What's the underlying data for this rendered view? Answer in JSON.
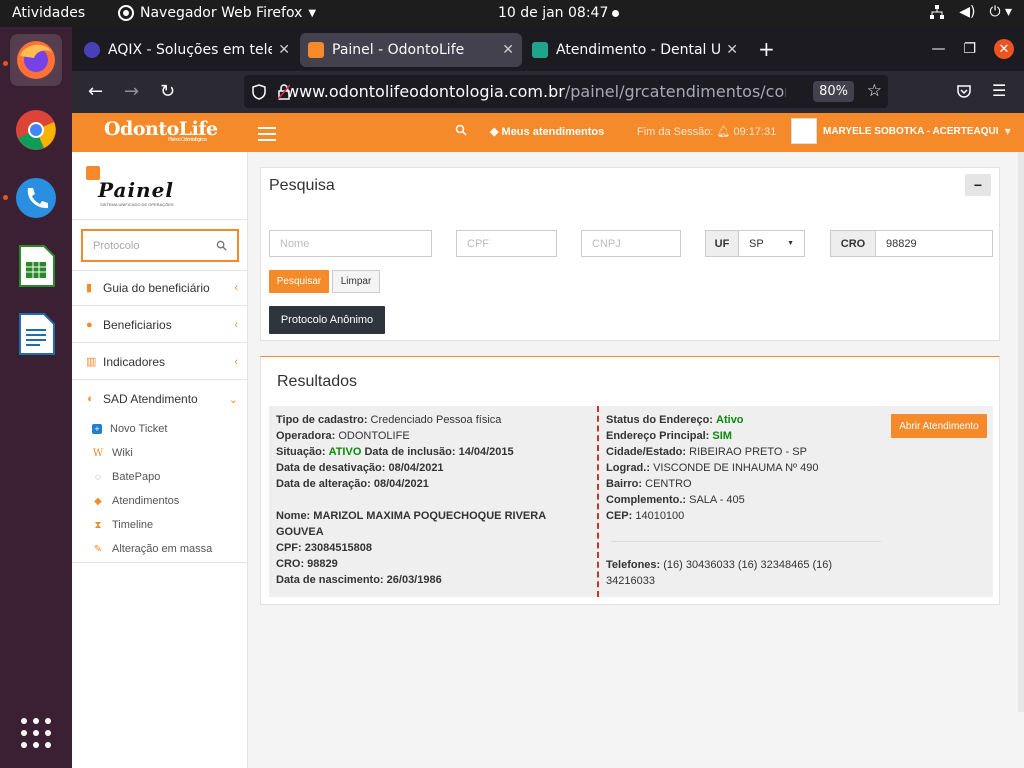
{
  "topbar": {
    "activities": "Atividades",
    "app_menu": "Navegador Web Firefox",
    "clock": "10 de jan  08:47"
  },
  "dock": {
    "apps": [
      "firefox-icon",
      "chrome-icon",
      "phone-icon",
      "calc-icon",
      "writer-icon",
      "apps-grid-icon"
    ]
  },
  "browser": {
    "tabs": [
      {
        "title": "AQIX - Soluções em telefonia",
        "active": false
      },
      {
        "title": "Painel - OdontoLife",
        "active": true
      },
      {
        "title": "Atendimento - Dental Uni",
        "active": false
      }
    ],
    "url_host": "www.odontolifeodontologia.com.br",
    "url_path": "/painel/grcatendimentos/consulta/i",
    "zoom": "80%"
  },
  "header": {
    "logo": "OdontoLife",
    "logo_sub": "Planos Odontológicos",
    "meus_atendimentos": "Meus atendimentos",
    "sessao_label": "Fim da Sessão:",
    "sessao_time": "09:17:31",
    "user": "MARYELE SOBOTKA - ACERTEAQUI"
  },
  "sidebar": {
    "painel": "Painel",
    "painel_sub": "SISTEMA UNIFICADO DE OPERAÇÕES",
    "protocolo_placeholder": "Protocolo",
    "menu": [
      {
        "label": "Guia do beneficiário"
      },
      {
        "label": "Beneficiarios"
      },
      {
        "label": "Indicadores"
      },
      {
        "label": "SAD Atendimento"
      }
    ],
    "submenu": [
      {
        "label": "Novo Ticket"
      },
      {
        "label": "Wiki"
      },
      {
        "label": "BatePapo"
      },
      {
        "label": "Atendimentos"
      },
      {
        "label": "Timeline"
      },
      {
        "label": "Alteração em massa"
      }
    ]
  },
  "pesquisa": {
    "title": "Pesquisa",
    "nome_placeholder": "Nome",
    "cpf_placeholder": "CPF",
    "cnpj_placeholder": "CNPJ",
    "uf_label": "UF",
    "uf_value": "SP",
    "cro_label": "CRO",
    "cro_value": "98829",
    "btn_pesquisar": "Pesquisar",
    "btn_limpar": "Limpar",
    "btn_anonimo": "Protocolo Anônimo"
  },
  "resultados": {
    "title": "Resultados",
    "btn_abrir": "Abrir Atendimento",
    "tipo_label": "Tipo de cadastro:",
    "tipo_value": "Credenciado Pessoa física",
    "operadora_label": "Operadora:",
    "operadora_value": "ODONTOLIFE",
    "situacao_label": "Situação:",
    "situacao_value": "ATIVO",
    "inclusao_label": "Data de inclusão:",
    "inclusao_value": "14/04/2015",
    "desativacao_label": "Data de desativação:",
    "desativacao_value": "08/04/2021",
    "alteracao_label": "Data de alteração:",
    "alteracao_value": "08/04/2021",
    "nome_label": "Nome:",
    "nome_value_1": "MARIZOL MAXIMA POQUECHOQUE RIVERA",
    "nome_value_2": "GOUVEA",
    "cpf_label": "CPF:",
    "cpf_value": "23084515808",
    "cro_label": "CRO:",
    "cro_value": "98829",
    "nasc_label": "Data de nascimento:",
    "nasc_value": "26/03/1986",
    "status_end_label": "Status do Endereço:",
    "status_end_value": "Ativo",
    "end_principal_label": "Endereço Principal:",
    "end_principal_value": "SIM",
    "cidade_label": "Cidade/Estado:",
    "cidade_value": "RIBEIRAO PRETO - SP",
    "lograd_label": "Lograd.:",
    "lograd_value": "VISCONDE DE INHAUMA Nº 490",
    "bairro_label": "Bairro:",
    "bairro_value": "CENTRO",
    "complemento_label": "Complemento.:",
    "complemento_value": "SALA - 405",
    "cep_label": "CEP:",
    "cep_value": "14010100",
    "telefones_label": "Telefones:",
    "telefones_value_1": "(16) 30436033 (16) 32348465 (16)",
    "telefones_value_2": "34216033"
  }
}
